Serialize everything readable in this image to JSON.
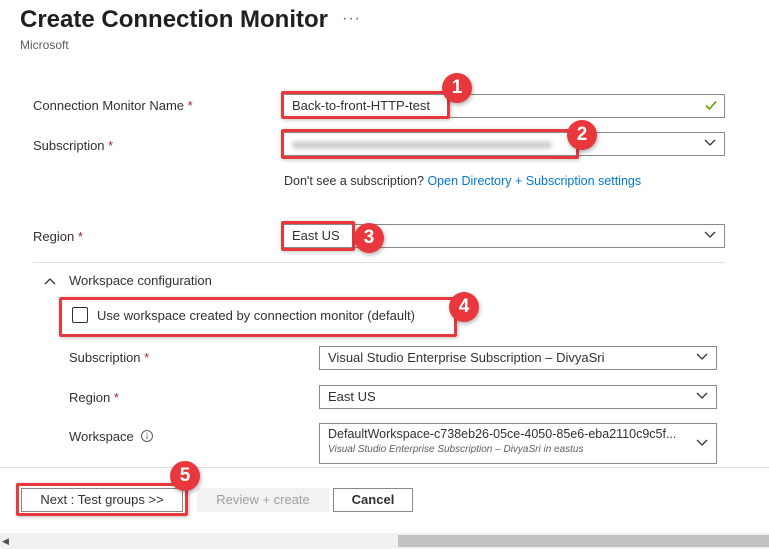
{
  "header": {
    "title": "Create Connection Monitor",
    "more": "···",
    "publisher": "Microsoft"
  },
  "form": {
    "name_label": "Connection Monitor Name",
    "name_value": "Back-to-front-HTTP-test",
    "subscription_label": "Subscription",
    "subscription_help_text": "Don't see a subscription?",
    "subscription_help_link": "Open Directory + Subscription settings",
    "region_label": "Region",
    "region_value": "East US",
    "required_marker": "*"
  },
  "workspace_config": {
    "section_title": "Workspace configuration",
    "use_default_label": "Use workspace created by connection monitor (default)",
    "use_default_checked": false,
    "subscription_label": "Subscription",
    "subscription_value": "Visual Studio Enterprise Subscription – DivyaSri",
    "region_label": "Region",
    "region_value": "East US",
    "workspace_label": "Workspace",
    "workspace_value": "DefaultWorkspace-c738eb26-05ce-4050-85e6-eba2110c9c5f...",
    "workspace_subvalue": "Visual Studio Enterprise Subscription – DivyaSri in eastus"
  },
  "footer": {
    "next_label": "Next : Test groups >>",
    "review_label": "Review + create",
    "cancel_label": "Cancel"
  },
  "annotations": {
    "badges": [
      "1",
      "2",
      "3",
      "4",
      "5"
    ],
    "color": "#e8383d"
  },
  "colors": {
    "link": "#0078d4",
    "required": "#a4262c",
    "valid_check": "#57a300"
  },
  "icons": {
    "more": "more-icon",
    "dropdown": "chevron-down-icon",
    "valid": "checkmark-icon",
    "collapse": "chevron-up-icon",
    "info": "info-icon"
  }
}
